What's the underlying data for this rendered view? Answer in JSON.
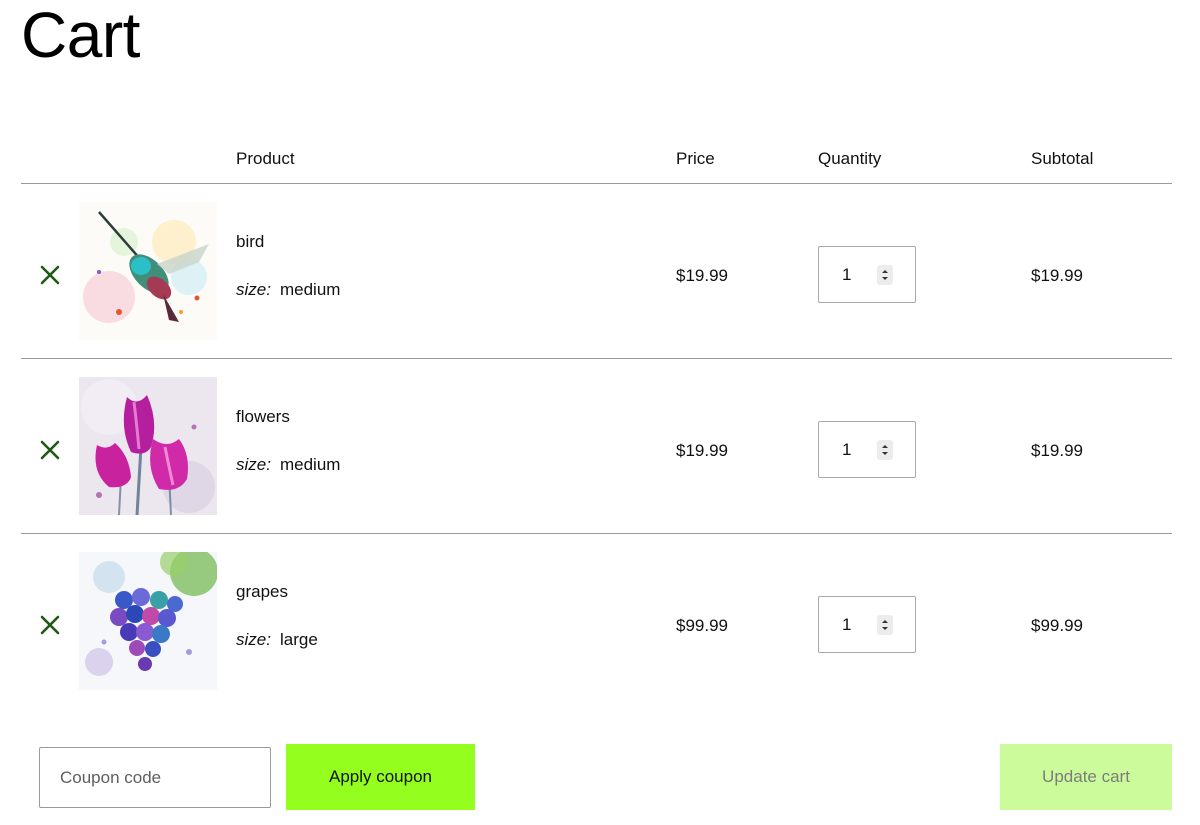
{
  "page": {
    "title": "Cart"
  },
  "table": {
    "headers": {
      "product": "Product",
      "price": "Price",
      "quantity": "Quantity",
      "subtotal": "Subtotal"
    }
  },
  "items": [
    {
      "name": "bird",
      "meta_key": "size:",
      "meta_value": "medium",
      "price": "$19.99",
      "quantity": "1",
      "subtotal": "$19.99",
      "remove_icon": "remove-x-icon",
      "thumbnail": "watercolor hummingbird"
    },
    {
      "name": "flowers",
      "meta_key": "size:",
      "meta_value": "medium",
      "price": "$19.99",
      "quantity": "1",
      "subtotal": "$19.99",
      "remove_icon": "remove-x-icon",
      "thumbnail": "watercolor pink tulips"
    },
    {
      "name": "grapes",
      "meta_key": "size:",
      "meta_value": "large",
      "price": "$99.99",
      "quantity": "1",
      "subtotal": "$99.99",
      "remove_icon": "remove-x-icon",
      "thumbnail": "watercolor grapes"
    }
  ],
  "actions": {
    "coupon_placeholder": "Coupon code",
    "apply_coupon_label": "Apply coupon",
    "update_cart_label": "Update cart"
  },
  "colors": {
    "remove_icon": "#1e5a12",
    "apply_button": "#94ff1f",
    "update_button_disabled": "#ccfb9b"
  }
}
